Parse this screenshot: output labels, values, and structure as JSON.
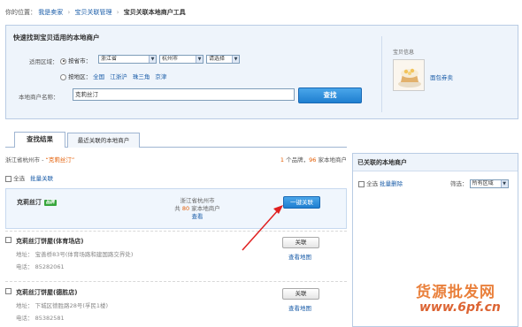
{
  "breadcrumb": {
    "prefix": "你的位置：",
    "items": [
      "我是卖家",
      "宝贝关联管理"
    ],
    "current": "宝贝关联本地商户工具"
  },
  "search_panel": {
    "title": "快速找到宝贝适用的本地商户",
    "region_label": "适用区域：",
    "by_city_label": "按省市：",
    "province_value": "浙江省",
    "city_value": "杭州市",
    "district_value": "请选择",
    "by_area_label": "按地区：",
    "area_links": [
      "全国",
      "江浙沪",
      "珠三角",
      "京津"
    ],
    "merchant_label": "本地商户名称：",
    "merchant_value": "克莉丝汀",
    "search_button": "查找"
  },
  "product_info": {
    "label": "宝贝信息",
    "name": "面包券卖"
  },
  "tabs": [
    {
      "label": "查找结果"
    },
    {
      "label": "最近关联的本地商户"
    }
  ],
  "results": {
    "location": "浙江省杭州市 - ",
    "keyword": "“克莉丝汀”",
    "count_brand": "1",
    "brand_suffix": " 个品牌，",
    "count_merchants": "96",
    "merchant_suffix": " 家本地商户",
    "select_all": "全选",
    "bulk_link": "批量关联"
  },
  "brand_row": {
    "name": "克莉丝汀",
    "badge": "品牌",
    "region": "浙江省杭州市",
    "count_prefix": "共 ",
    "count": "80",
    "count_suffix": " 家本地商户",
    "view": "查看",
    "button": "一键关联"
  },
  "merchants": [
    {
      "name": "克莉丝汀饼屋(体育场店)",
      "address": "地址： 宝善桥83号(体育场路和建国路交界处)",
      "phone": "电话： 85282061",
      "button": "关联",
      "map_link": "查看地图"
    },
    {
      "name": "克莉丝汀饼屋(德胜店)",
      "address": "地址： 下城区德胜路28号(孚民1楼)",
      "phone": "电话： 85382581",
      "button": "关联",
      "map_link": "查看地图"
    }
  ],
  "linked_panel": {
    "title": "已关联的本地商户",
    "select_all": "全选",
    "bulk_unlink": "批量删除",
    "filter_label": "筛选：",
    "filter_value": "所有区域"
  },
  "watermark": {
    "text_cn": "货源批发网",
    "url": "www.6pf.cn"
  },
  "colors": {
    "accent": "#1f7fd0",
    "link": "#1a5ca8",
    "highlight": "#e35b00",
    "arrow": "#e02020"
  }
}
